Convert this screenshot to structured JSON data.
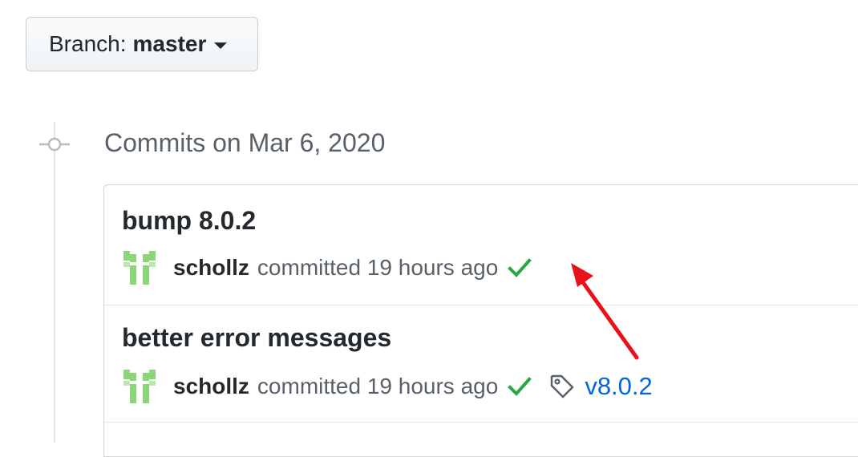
{
  "branch": {
    "label": "Branch:",
    "name": "master"
  },
  "timeline": {
    "header": "Commits on Mar 6, 2020"
  },
  "commits": [
    {
      "title": "bump 8.0.2",
      "author": "schollz",
      "action": "committed 19 hours ago",
      "status": "success",
      "tag": ""
    },
    {
      "title": "better error messages",
      "author": "schollz",
      "action": "committed 19 hours ago",
      "status": "success",
      "tag": "v8.0.2"
    }
  ],
  "colors": {
    "success": "#28a745",
    "link": "#0366d6",
    "annotation": "#e8131a",
    "avatar": "#8cd67a"
  },
  "icons": {
    "branch_caret": "caret-down-icon",
    "timeline": "git-commit-icon",
    "status": "check-icon",
    "tag": "tag-icon"
  }
}
